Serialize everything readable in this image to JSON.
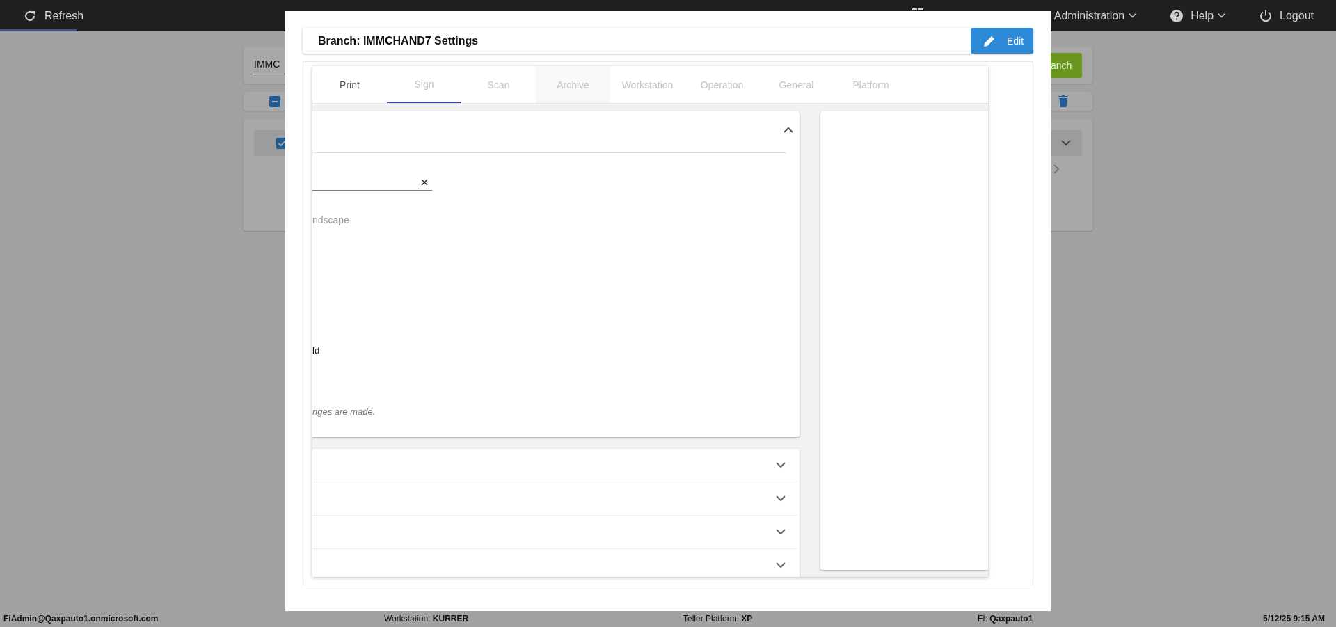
{
  "top_bar": {
    "refresh": "Refresh",
    "menus": [
      {
        "label": "Administration",
        "kind": "dropdown"
      },
      {
        "label": "Help",
        "kind": "dropdown"
      },
      {
        "label": "Logout",
        "kind": "action"
      }
    ]
  },
  "background": {
    "search_value": "IMMC",
    "add_button": "anch",
    "select_all": {
      "indeterminate": true
    },
    "row": {
      "checked": true,
      "expanded": false
    }
  },
  "modal": {
    "title": "Branch: IMMCHAND7 Settings",
    "edit_button": "Edit",
    "tabs": [
      {
        "label": "Print",
        "selected": false,
        "disabled": false
      },
      {
        "label": "Sign",
        "selected": true,
        "disabled": true
      },
      {
        "label": "Scan",
        "selected": false,
        "disabled": true
      },
      {
        "label": "Archive",
        "selected": false,
        "disabled": true
      },
      {
        "label": "Workstation",
        "selected": false,
        "disabled": true
      },
      {
        "label": "Operation",
        "selected": false,
        "disabled": true
      },
      {
        "label": "General",
        "selected": false,
        "disabled": true
      },
      {
        "label": "Platform",
        "selected": false,
        "disabled": true
      }
    ],
    "section": {
      "expanded": true,
      "texts": [
        {
          "text": "ndscape",
          "kind": "hint"
        },
        {
          "text": "ld",
          "kind": "label"
        },
        {
          "text": "nges are made.",
          "kind": "note"
        }
      ]
    },
    "collapsed_sections": [
      {
        "expanded": false
      },
      {
        "expanded": false
      },
      {
        "expanded": false
      },
      {
        "expanded": false
      }
    ]
  },
  "status_bar": {
    "user": "FiAdmin@Qaxpauto1.onmicrosoft.com",
    "workstation": "Workstation: **KURRER**",
    "platform": "Teller Platform: **XP**",
    "fi": "FI: **Qaxpauto1**",
    "datetime": "5/12/25 9:15 AM"
  }
}
